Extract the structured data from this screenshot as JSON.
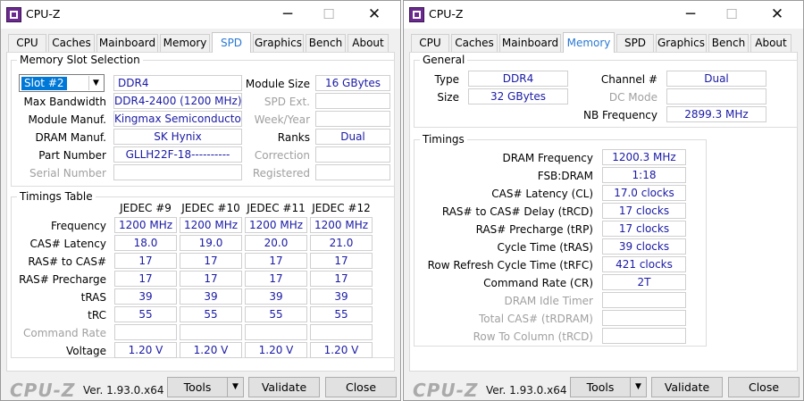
{
  "left": {
    "title": "CPU-Z",
    "tabs": [
      "CPU",
      "Caches",
      "Mainboard",
      "Memory",
      "SPD",
      "Graphics",
      "Bench",
      "About"
    ],
    "active_tab": "SPD",
    "slot_group_title": "Memory Slot Selection",
    "slot_value": "Slot #2",
    "mem_type": "DDR4",
    "module_size_label": "Module Size",
    "module_size": "16 GBytes",
    "max_bw_label": "Max Bandwidth",
    "max_bw": "DDR4-2400 (1200 MHz)",
    "spd_ext_label": "SPD Ext.",
    "module_manuf_label": "Module Manuf.",
    "module_manuf": "Kingmax Semiconductor",
    "week_year_label": "Week/Year",
    "dram_manuf_label": "DRAM Manuf.",
    "dram_manuf": "SK Hynix",
    "ranks_label": "Ranks",
    "ranks": "Dual",
    "part_number_label": "Part Number",
    "part_number": "GLLH22F-18----------",
    "correction_label": "Correction",
    "serial_label": "Serial Number",
    "registered_label": "Registered",
    "timings_title": "Timings Table",
    "jedec_headers": [
      "JEDEC #9",
      "JEDEC #10",
      "JEDEC #11",
      "JEDEC #12"
    ],
    "timing_rows": [
      {
        "label": "Frequency",
        "values": [
          "1200 MHz",
          "1200 MHz",
          "1200 MHz",
          "1200 MHz"
        ]
      },
      {
        "label": "CAS# Latency",
        "values": [
          "18.0",
          "19.0",
          "20.0",
          "21.0"
        ]
      },
      {
        "label": "RAS# to CAS#",
        "values": [
          "17",
          "17",
          "17",
          "17"
        ]
      },
      {
        "label": "RAS# Precharge",
        "values": [
          "17",
          "17",
          "17",
          "17"
        ]
      },
      {
        "label": "tRAS",
        "values": [
          "39",
          "39",
          "39",
          "39"
        ]
      },
      {
        "label": "tRC",
        "values": [
          "55",
          "55",
          "55",
          "55"
        ]
      },
      {
        "label": "Command Rate",
        "values": [
          "",
          "",
          "",
          ""
        ],
        "dim": true
      },
      {
        "label": "Voltage",
        "values": [
          "1.20 V",
          "1.20 V",
          "1.20 V",
          "1.20 V"
        ]
      }
    ],
    "footer": {
      "logo": "CPU-Z",
      "version": "Ver. 1.93.0.x64",
      "tools": "Tools",
      "validate": "Validate",
      "close": "Close"
    }
  },
  "right": {
    "title": "CPU-Z",
    "tabs": [
      "CPU",
      "Caches",
      "Mainboard",
      "Memory",
      "SPD",
      "Graphics",
      "Bench",
      "About"
    ],
    "active_tab": "Memory",
    "general_title": "General",
    "type_label": "Type",
    "type": "DDR4",
    "channel_label": "Channel #",
    "channel": "Dual",
    "size_label": "Size",
    "size": "32 GBytes",
    "dc_mode_label": "DC Mode",
    "nb_freq_label": "NB Frequency",
    "nb_freq": "2899.3 MHz",
    "timings_title": "Timings",
    "timing_rows": [
      {
        "label": "DRAM Frequency",
        "value": "1200.3 MHz"
      },
      {
        "label": "FSB:DRAM",
        "value": "1:18"
      },
      {
        "label": "CAS# Latency (CL)",
        "value": "17.0 clocks"
      },
      {
        "label": "RAS# to CAS# Delay (tRCD)",
        "value": "17 clocks"
      },
      {
        "label": "RAS# Precharge (tRP)",
        "value": "17 clocks"
      },
      {
        "label": "Cycle Time (tRAS)",
        "value": "39 clocks"
      },
      {
        "label": "Row Refresh Cycle Time (tRFC)",
        "value": "421 clocks"
      },
      {
        "label": "Command Rate (CR)",
        "value": "2T"
      },
      {
        "label": "DRAM Idle Timer",
        "value": "",
        "dim": true
      },
      {
        "label": "Total CAS# (tRDRAM)",
        "value": "",
        "dim": true
      },
      {
        "label": "Row To Column (tRCD)",
        "value": "",
        "dim": true
      }
    ],
    "footer": {
      "logo": "CPU-Z",
      "version": "Ver. 1.93.0.x64",
      "tools": "Tools",
      "validate": "Validate",
      "close": "Close"
    }
  }
}
